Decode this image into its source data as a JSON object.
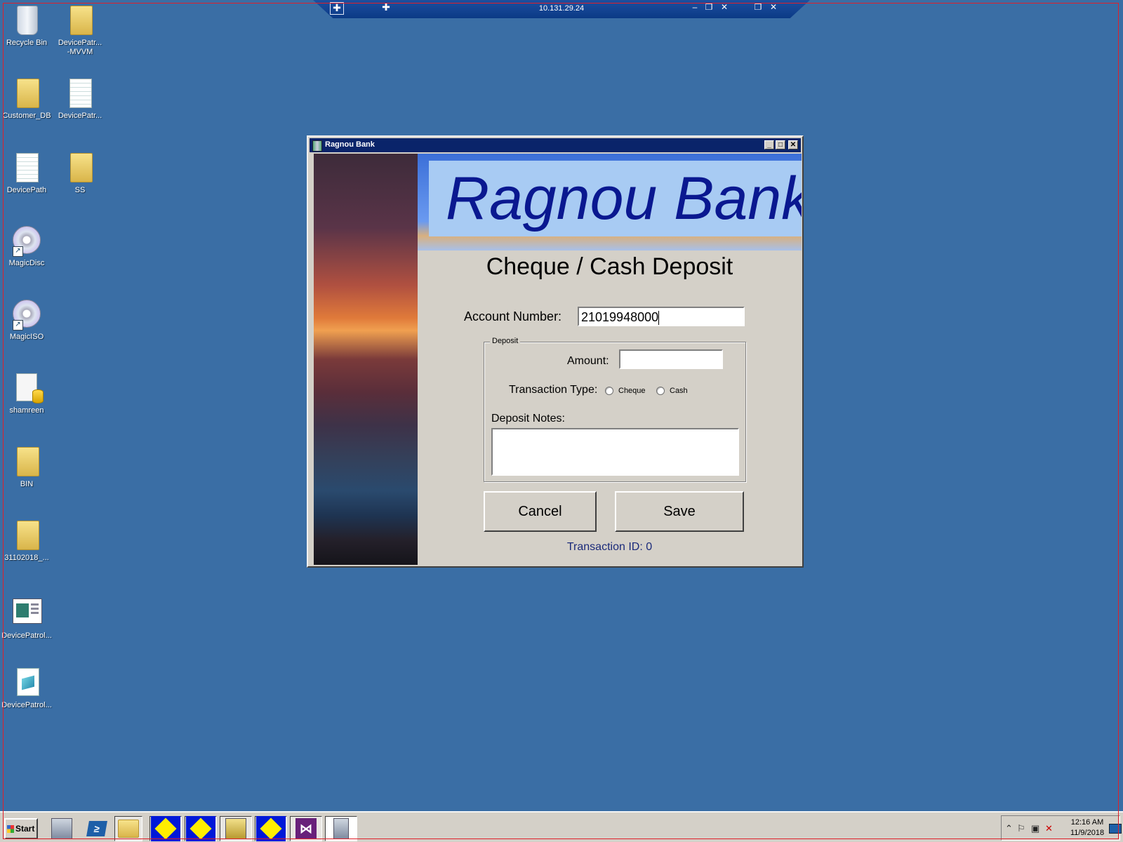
{
  "rdp_bar": {
    "host": "10.131.29.24",
    "pin_icon": "pin-icon",
    "minimize_glyph": "–",
    "restore_glyph": "❐",
    "close_glyph": "✕"
  },
  "desktop_icons": [
    {
      "label": "Recycle Bin",
      "icon": "recycle-bin-icon"
    },
    {
      "label": "DevicePatr...\n-MVVM",
      "icon": "folder-icon"
    },
    {
      "label": "Customer_DB",
      "icon": "folder-icon"
    },
    {
      "label": "DevicePatr...",
      "icon": "text-document-icon"
    },
    {
      "label": "DevicePath",
      "icon": "text-document-icon"
    },
    {
      "label": "SS",
      "icon": "folder-icon"
    },
    {
      "label": "MagicDisc",
      "icon": "disc-shortcut-icon"
    },
    {
      "label": "MagicISO",
      "icon": "disc-shortcut-icon"
    },
    {
      "label": "shamreen",
      "icon": "database-document-icon"
    },
    {
      "label": "BIN",
      "icon": "folder-icon"
    },
    {
      "label": "31102018_...",
      "icon": "folder-icon"
    },
    {
      "label": "DevicePatrol...",
      "icon": "window-app-icon"
    },
    {
      "label": "DevicePatrol...",
      "icon": "xml-document-icon"
    }
  ],
  "app": {
    "window_title": "Ragnou Bank",
    "banner_text": "Ragnou Bank",
    "form_title": "Cheque / Cash Deposit",
    "account_label": "Account Number:",
    "account_value": "21019948000",
    "group_title": "Deposit",
    "amount_label": "Amount:",
    "amount_value": "",
    "transaction_type_label": "Transaction Type:",
    "radio_cheque": "Cheque",
    "radio_cash": "Cash",
    "notes_label": "Deposit Notes:",
    "notes_value": "",
    "cancel_label": "Cancel",
    "save_label": "Save",
    "transaction_id_text": "Transaction ID: 0"
  },
  "taskbar": {
    "start_label": "Start",
    "items": [
      {
        "icon": "server-manager-icon"
      },
      {
        "icon": "powershell-icon"
      },
      {
        "icon": "file-explorer-icon"
      },
      {
        "icon": "yellow-diamond-app-icon"
      },
      {
        "icon": "yellow-diamond-app-icon"
      },
      {
        "icon": "tools-icon"
      },
      {
        "icon": "yellow-diamond-app-icon"
      },
      {
        "icon": "visual-studio-icon"
      },
      {
        "icon": "ragnou-bank-app-icon"
      }
    ],
    "clock_time": "12:16 AM",
    "clock_date": "11/9/2018"
  },
  "colors": {
    "desktop_bg": "#3a6ea5",
    "titlebar_bg": "#0a246a",
    "banner_text": "#0a1890",
    "window_bg": "#d4d0c8"
  }
}
